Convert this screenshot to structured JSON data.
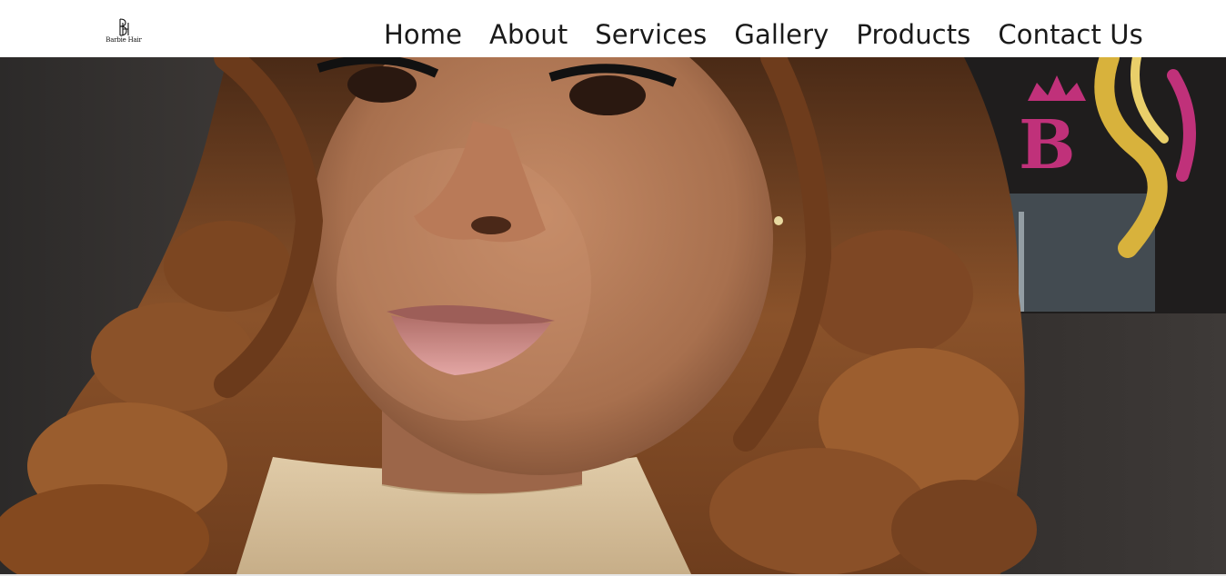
{
  "brand": {
    "logo_text": "Barbie Hair",
    "logo_icon": "bh-monogram-icon"
  },
  "nav": {
    "items": [
      {
        "label": "Home"
      },
      {
        "label": "About"
      },
      {
        "label": "Services"
      },
      {
        "label": "Gallery"
      },
      {
        "label": "Products"
      },
      {
        "label": "Contact Us"
      }
    ]
  },
  "hero": {
    "image": "hero-portrait-image",
    "colors": {
      "background": "#3a3532",
      "hair": "#7a4722",
      "skin": "#b97a58",
      "sweater": "#d8c3a0",
      "sign_pink": "#c0317a",
      "sign_gold": "#d8b23c"
    }
  }
}
